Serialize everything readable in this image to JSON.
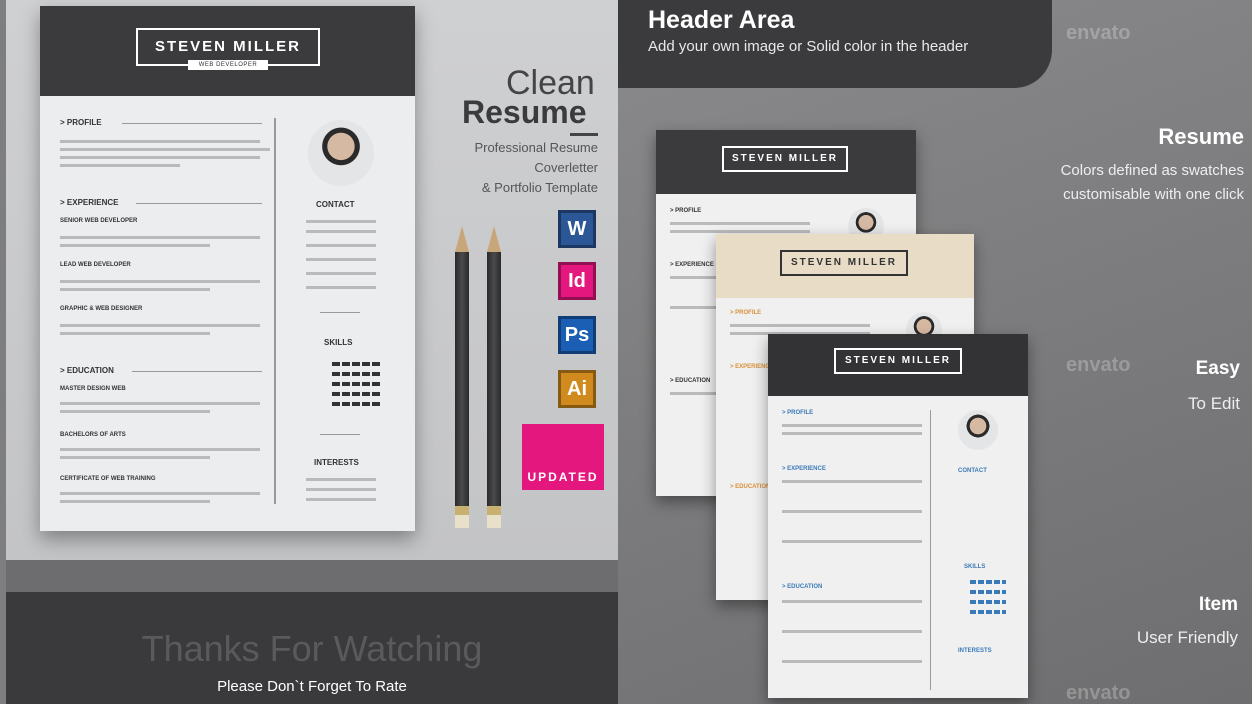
{
  "header_area": {
    "title": "Header Area",
    "subtitle": "Add your own image or Solid color in the header"
  },
  "features": [
    {
      "bold": "Resume",
      "line1": "Colors defined as swatches",
      "line2": "customisable with one click"
    },
    {
      "bold": "Easy",
      "line1": "To Edit"
    },
    {
      "bold": "Item",
      "line1": "User Friendly"
    }
  ],
  "product": {
    "clean": "Clean",
    "resume": "Resume",
    "line1": "Professional Resume",
    "line2": "Coverletter",
    "line3": "& Portfolio Template",
    "updated": "UPDATED"
  },
  "app_icons": [
    {
      "name": "word-icon",
      "label": "W",
      "color": "#2b5797"
    },
    {
      "name": "indesign-icon",
      "label": "Id",
      "color": "#e3177d"
    },
    {
      "name": "photoshop-icon",
      "label": "Ps",
      "color": "#1a5fb4"
    },
    {
      "name": "illustrator-icon",
      "label": "Ai",
      "color": "#d08a1e"
    }
  ],
  "resume": {
    "name": "STEVEN MILLER",
    "role": "WEB DEVELOPER",
    "sections": {
      "profile": "> PROFILE",
      "experience": "> EXPERIENCE",
      "education": "> EDUCATION",
      "contact": "CONTACT",
      "skills": "SKILLS",
      "interests": "INTERESTS"
    },
    "jobs": [
      "SENIOR WEB DEVELOPER",
      "LEAD WEB DEVELOPER",
      "GRAPHIC & WEB DESIGNER"
    ],
    "schools": [
      "MASTER DESIGN WEB",
      "BACHELORS OF ARTS",
      "CERTIFICATE OF WEB TRAINING"
    ]
  },
  "footer": {
    "thanks": "Thanks For Watching",
    "rate": "Please Don`t Forget To Rate"
  },
  "watermark": "envato",
  "colors": {
    "dark": "#3b3b3d",
    "updated_pink": "#e3177d",
    "beige_header": "#e8dcc6",
    "accent_orange": "#d9903a",
    "accent_blue": "#3a7ab8"
  }
}
